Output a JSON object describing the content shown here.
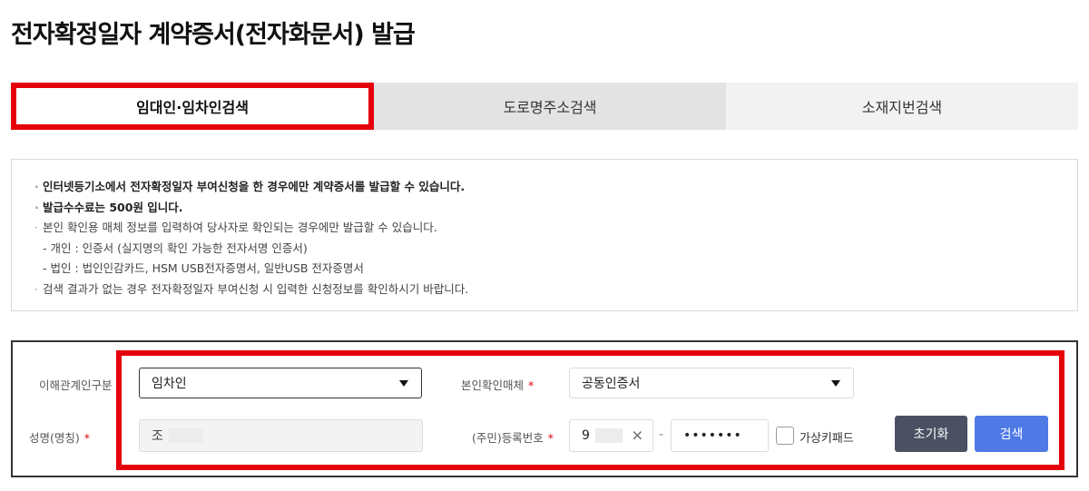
{
  "page_title": "전자확정일자 계약증서(전자화문서) 발급",
  "tabs": [
    {
      "label": "임대인·임차인검색",
      "active": true
    },
    {
      "label": "도로명주소검색",
      "active": false
    },
    {
      "label": "소재지번검색",
      "active": false
    }
  ],
  "notices": [
    {
      "text": "인터넷등기소에서 전자확정일자 부여신청을 한 경우에만 계약증서를 발급할 수 있습니다."
    },
    {
      "text": "발급수수료는 500원 입니다."
    },
    {
      "text": "본인 확인용 매체 정보를 입력하여 당사자로 확인되는 경우에만 발급할 수 있습니다."
    },
    {
      "text": "- 개인 : 인증서 (실지명의 확인 가능한 전자서명 인증서)"
    },
    {
      "text": "- 법인 : 법인인감카드, HSM USB전자증명서, 일반USB 전자증명서"
    },
    {
      "text": "검색 결과가 없는 경우 전자확정일자 부여신청 시 입력한 신청정보를 확인하시기 바랍니다."
    }
  ],
  "form": {
    "relation_label": "이해관계인구분",
    "relation_value": "임차인",
    "auth_media_label": "본인확인매체",
    "auth_media_value": "공동인증서",
    "name_label": "성명(명칭)",
    "name_value": "조",
    "regno_label": "(주민)등록번호",
    "regno_front": "9",
    "regno_dash": "-",
    "regno_back": "•••••••",
    "required_mark": "*",
    "virtual_keypad_label": "가상키패드",
    "reset_button": "초기화",
    "search_button": "검색"
  },
  "colors": {
    "highlight": "#e5000b",
    "reset_button": "#4b5062",
    "search_button": "#4f7ae6"
  }
}
